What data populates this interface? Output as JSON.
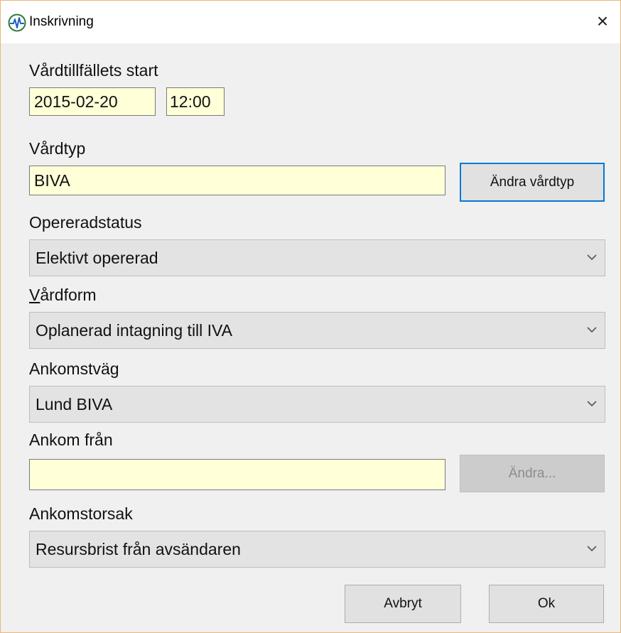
{
  "window": {
    "title": "Inskrivning",
    "close_label": "×",
    "icon": "heartbeat-icon"
  },
  "form": {
    "start": {
      "label": "Vårdtillfällets start",
      "date": "2015-02-20",
      "time": "12:00"
    },
    "vardtyp": {
      "label": "Vårdtyp",
      "value": "BIVA",
      "button": "Ändra vårdtyp"
    },
    "opereradstatus": {
      "label": "Opereradstatus",
      "value": "Elektivt opererad"
    },
    "vardform": {
      "label_mnemonic": "V",
      "label_rest": "årdform",
      "value": "Oplanerad intagning till IVA"
    },
    "ankomstvag": {
      "label": "Ankomstväg",
      "value": "Lund BIVA"
    },
    "ankom_fran": {
      "label": "Ankom från",
      "value": "",
      "button": "Ändra..."
    },
    "ankomstorsak": {
      "label": "Ankomstorsak",
      "value": "Resursbrist från avsändaren"
    }
  },
  "footer": {
    "cancel": "Avbryt",
    "ok": "Ok"
  },
  "colors": {
    "field_yellow": "#ffffd8",
    "dialog_bg": "#f0f0f0",
    "focus_blue": "#0078d7"
  }
}
